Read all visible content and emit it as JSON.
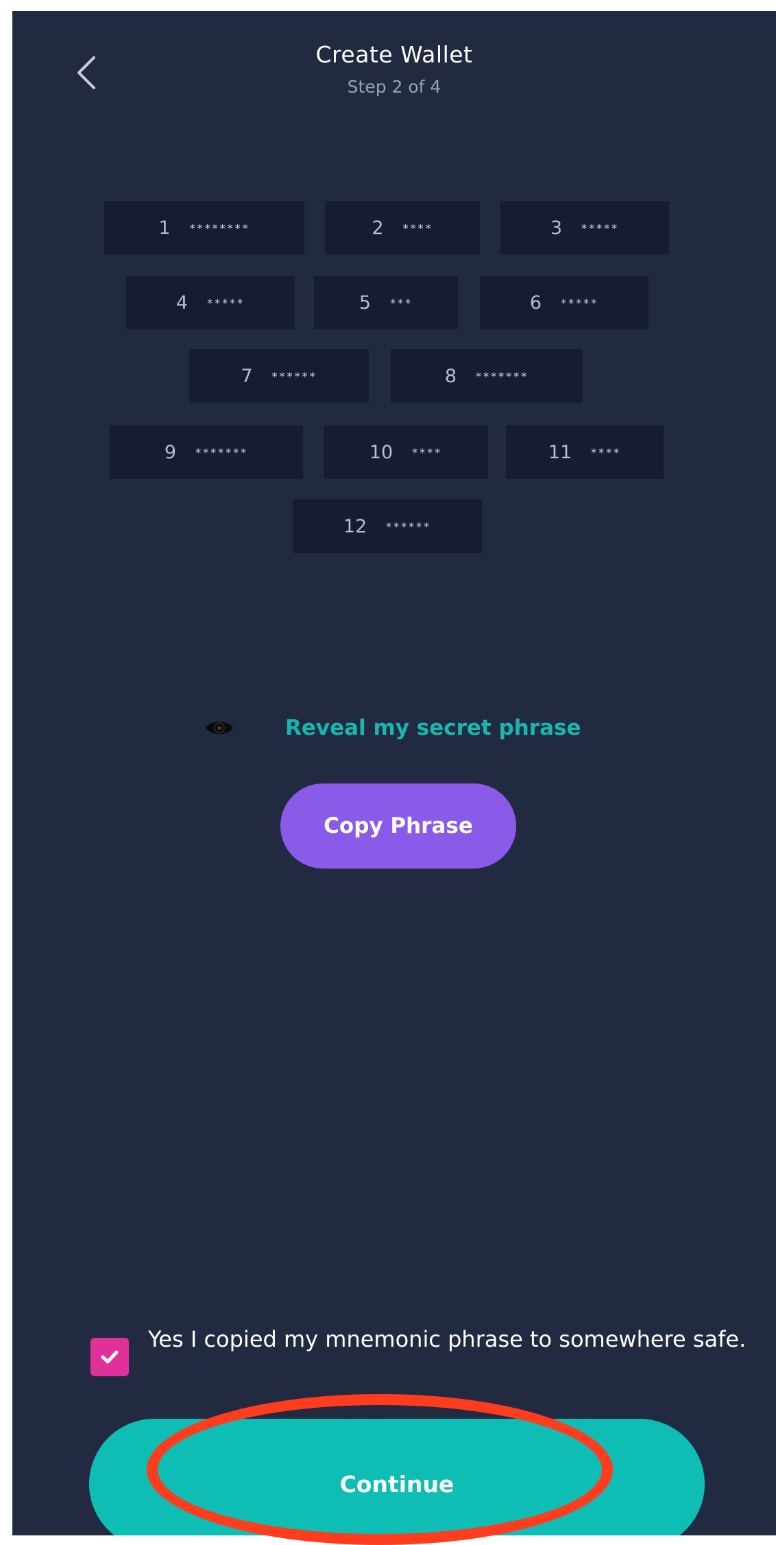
{
  "header": {
    "title": "Create Wallet",
    "subtitle": "Step 2 of 4",
    "back_icon": "chevron-left-icon"
  },
  "phrase_words": [
    {
      "index": "1",
      "masked": "********"
    },
    {
      "index": "2",
      "masked": "****"
    },
    {
      "index": "3",
      "masked": "*****"
    },
    {
      "index": "4",
      "masked": "*****"
    },
    {
      "index": "5",
      "masked": "***"
    },
    {
      "index": "6",
      "masked": "*****"
    },
    {
      "index": "7",
      "masked": "******"
    },
    {
      "index": "8",
      "masked": "*******"
    },
    {
      "index": "9",
      "masked": "*******"
    },
    {
      "index": "10",
      "masked": "****"
    },
    {
      "index": "11",
      "masked": "****"
    },
    {
      "index": "12",
      "masked": "******"
    }
  ],
  "reveal": {
    "label": "Reveal my secret phrase",
    "icon": "eye-icon"
  },
  "copy_button": {
    "label": "Copy Phrase"
  },
  "confirm": {
    "checked": true,
    "label": "Yes I copied my mnemonic phrase to somewhere safe."
  },
  "continue_button": {
    "label": "Continue"
  },
  "colors": {
    "background": "#222a42",
    "word_tile": "#171d31",
    "accent_teal": "#0ebdb4",
    "accent_purple": "#8a5be8",
    "checkbox_pink": "#e0309a",
    "annotation_red": "#ff3c1e"
  }
}
